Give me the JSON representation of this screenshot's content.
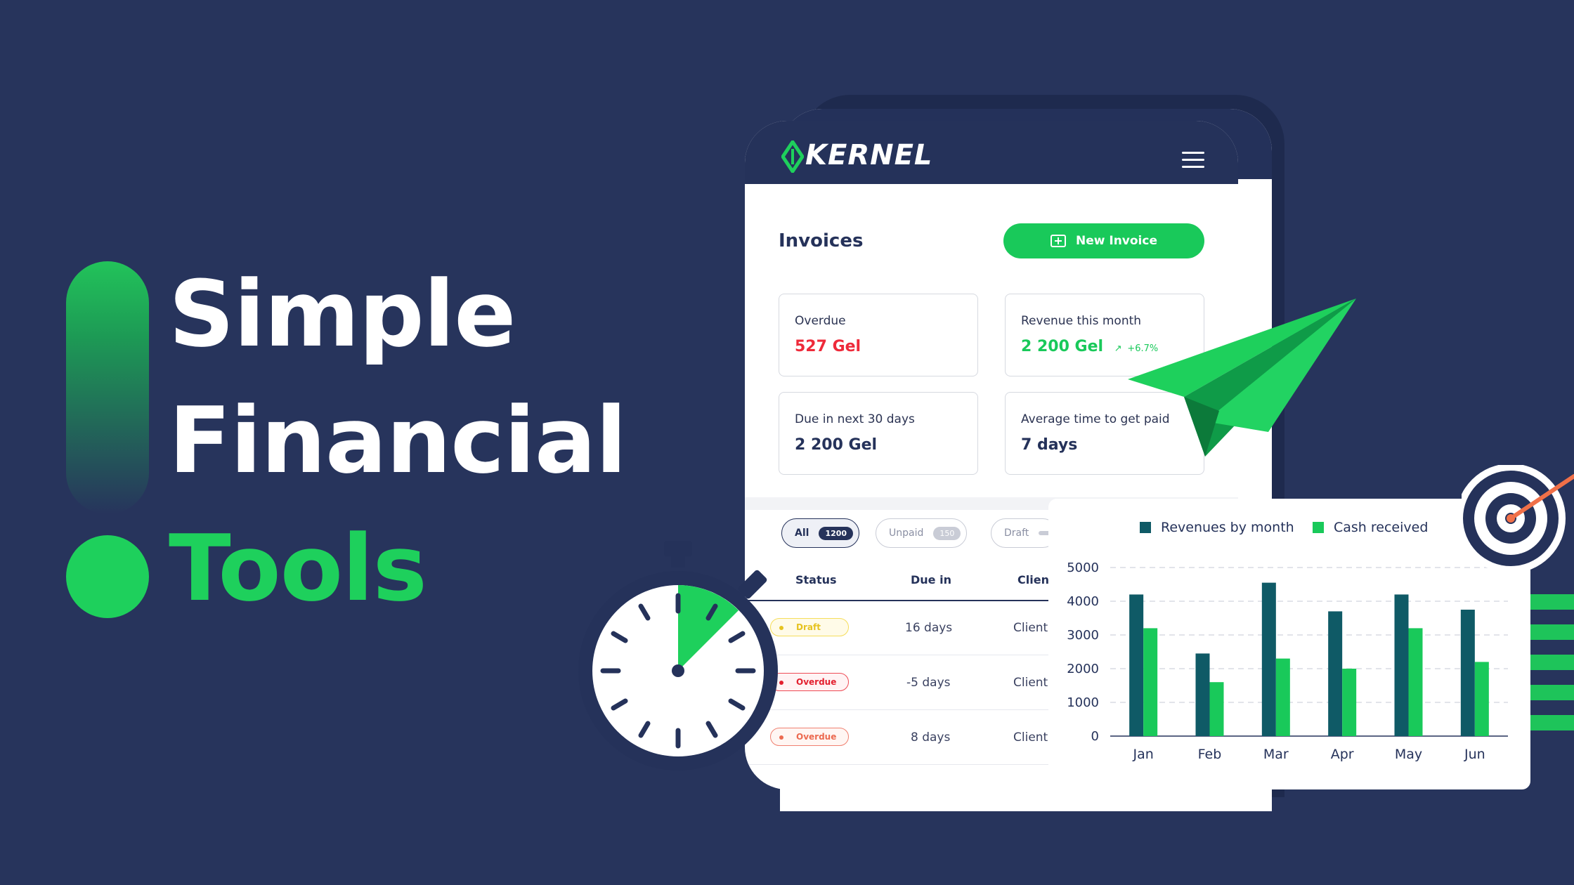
{
  "headline": {
    "line1": "Simple",
    "line2": "Financial",
    "line3": "Tools"
  },
  "app": {
    "logo_text": "KERNEL",
    "page_title": "Invoices",
    "new_invoice_label": "New Invoice"
  },
  "stats": [
    {
      "label": "Overdue",
      "value": "527 Gel",
      "color": "#ee2a3a"
    },
    {
      "label": "Revenue this month",
      "value": "2 200 Gel",
      "trend": "+6.7%",
      "color": "#19c95a"
    },
    {
      "label": "Due in next 30 days",
      "value": "2 200 Gel"
    },
    {
      "label": "Average time to get paid",
      "value": "7 days"
    }
  ],
  "filters": [
    {
      "label": "All",
      "count": "1200",
      "active": true
    },
    {
      "label": "Unpaid",
      "count": "150"
    },
    {
      "label": "Draft",
      "count": ""
    }
  ],
  "table": {
    "headers": [
      "Status",
      "Due in",
      "Client"
    ],
    "rows": [
      {
        "status": "Draft",
        "due": "16 days",
        "client": "Client"
      },
      {
        "status": "Overdue",
        "due": "-5 days",
        "client": "Client"
      },
      {
        "status": "Overdue",
        "due": "8 days",
        "client": "Client"
      }
    ]
  },
  "colors": {
    "background": "#27345c",
    "brand_green": "#1ed05c",
    "dark_series": "#0f5a66",
    "light_series": "#19c95a"
  },
  "icons": [
    "kernel-logo-icon",
    "menu-icon",
    "folder-plus-icon",
    "trend-up-icon",
    "paper-plane-icon",
    "stopwatch-icon",
    "target-icon"
  ],
  "chart_data": {
    "type": "bar",
    "categories": [
      "Jan",
      "Feb",
      "Mar",
      "Apr",
      "May",
      "Jun"
    ],
    "series": [
      {
        "name": "Revenues by month",
        "values": [
          4200,
          2450,
          4550,
          3700,
          4200,
          3750
        ],
        "color": "#0f5a66"
      },
      {
        "name": "Cash received",
        "values": [
          3200,
          1600,
          2300,
          2000,
          3200,
          2200
        ],
        "color": "#19c95a"
      }
    ],
    "yticks": [
      "5000",
      "4000",
      "3000",
      "2000",
      "1000",
      "0"
    ],
    "ylim": [
      0,
      5000
    ],
    "grid": true,
    "legend": "top"
  }
}
